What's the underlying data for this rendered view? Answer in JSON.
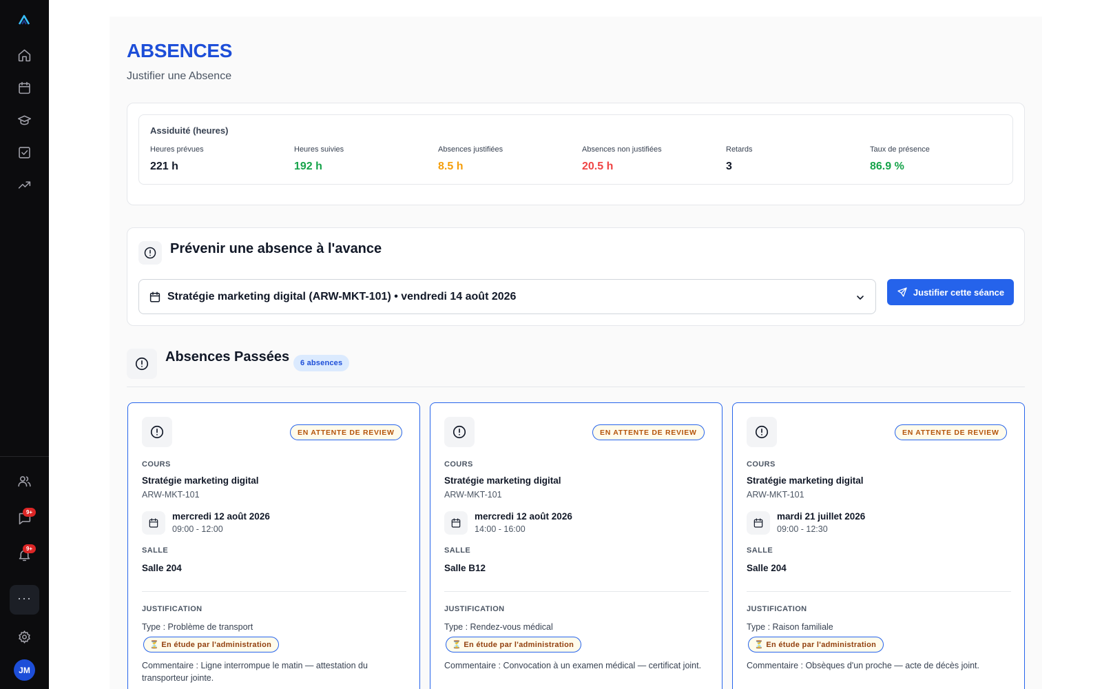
{
  "sidebar": {
    "items": [
      {
        "icon": "home-icon",
        "label": "home"
      },
      {
        "icon": "calendar-icon",
        "label": "calendar"
      },
      {
        "icon": "graduation-cap-icon",
        "label": "courses"
      },
      {
        "icon": "checkbox-icon",
        "label": "tasks"
      },
      {
        "icon": "trending-up-icon",
        "label": "progress"
      }
    ],
    "bottom": {
      "messages_badge": "9+",
      "notifications_badge": "9+",
      "more_label": "···",
      "avatar_initials": "JM"
    }
  },
  "header": {
    "title": "ABSENCES",
    "subtitle": "Justifier une Absence"
  },
  "stats": {
    "title": "Assiduité (heures)",
    "items": [
      {
        "label": "Heures prévues",
        "value": "221 h",
        "color": "#111827"
      },
      {
        "label": "Heures suivies",
        "value": "192 h",
        "color": "#16a34a"
      },
      {
        "label": "Absences justifiées",
        "value": "8.5 h",
        "color": "#f59e0b"
      },
      {
        "label": "Absences non justifiées",
        "value": "20.5 h",
        "color": "#ef4444"
      },
      {
        "label": "Retards",
        "value": "3",
        "color": "#111827"
      },
      {
        "label": "Taux de présence",
        "value": "86.9 %",
        "color": "#16a34a"
      }
    ]
  },
  "prevent": {
    "title": "Prévenir une absence à l'avance",
    "selected_session": "Stratégie marketing digital (ARW-MKT-101) • vendredi 14 août 2026",
    "button_label": "Justifier cette séance"
  },
  "past": {
    "title": "Absences Passées",
    "count_label": "6 absences",
    "labels": {
      "course": "COURS",
      "room": "SALLE",
      "justification": "JUSTIFICATION"
    },
    "cards": [
      {
        "status": "EN ATTENTE DE REVIEW",
        "course_name": "Stratégie marketing digital",
        "course_code": "ARW-MKT-101",
        "date": "mercredi 12 août 2026",
        "time": "09:00 - 12:00",
        "room": "Salle 204",
        "type": "Type : Problème de transport",
        "review_status": "⏳ En étude par l'administration",
        "comment": "Commentaire : Ligne interrompue le matin — attestation du transporteur jointe."
      },
      {
        "status": "EN ATTENTE DE REVIEW",
        "course_name": "Stratégie marketing digital",
        "course_code": "ARW-MKT-101",
        "date": "mercredi 12 août 2026",
        "time": "14:00 - 16:00",
        "room": "Salle B12",
        "type": "Type : Rendez-vous médical",
        "review_status": "⏳ En étude par l'administration",
        "comment": "Commentaire : Convocation à un examen médical — certificat joint."
      },
      {
        "status": "EN ATTENTE DE REVIEW",
        "course_name": "Stratégie marketing digital",
        "course_code": "ARW-MKT-101",
        "date": "mardi 21 juillet 2026",
        "time": "09:00 - 12:30",
        "room": "Salle 204",
        "type": "Type : Raison familiale",
        "review_status": "⏳ En étude par l'administration",
        "comment": "Commentaire : Obsèques d'un proche — acte de décès joint."
      }
    ]
  },
  "colors": {
    "accent": "#2563eb",
    "title": "#1d4ed8",
    "pending_text": "#b45309"
  }
}
